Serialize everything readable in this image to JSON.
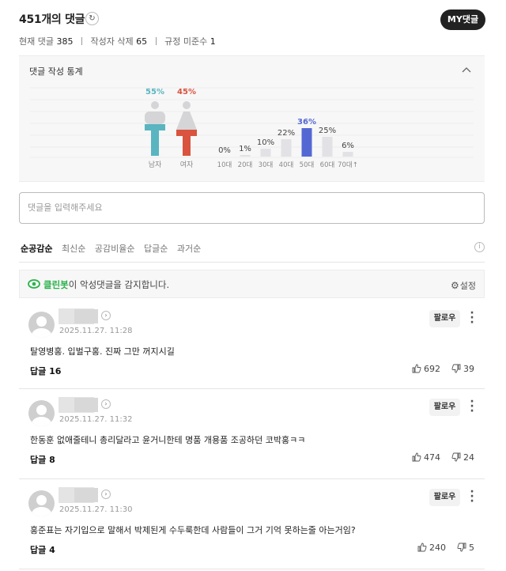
{
  "header": {
    "title": "451개의 댓글",
    "my_button": "MY댓글"
  },
  "counts": {
    "current_label": "현재 댓글",
    "current_value": "385",
    "deleted_label": "작성자 삭제",
    "deleted_value": "65",
    "violation_label": "규정 미준수",
    "violation_value": "1"
  },
  "stats": {
    "title": "댓글 작성 통계",
    "chart_data": {
      "type": "bar",
      "gender": [
        {
          "name": "남자",
          "value": 55,
          "label": "55%",
          "color": "#5ab5c0"
        },
        {
          "name": "여자",
          "value": 45,
          "label": "45%",
          "color": "#d9533f"
        }
      ],
      "age": {
        "categories": [
          "10대",
          "20대",
          "30대",
          "40대",
          "50대",
          "60대",
          "70대↑"
        ],
        "values": [
          0,
          1,
          10,
          22,
          36,
          25,
          6
        ],
        "labels": [
          "0%",
          "1%",
          "10%",
          "22%",
          "36%",
          "25%",
          "6%"
        ],
        "highlight_color": "#5468d4",
        "bar_color": "#e2e2e6"
      }
    }
  },
  "input": {
    "placeholder": "댓글을 입력해주세요"
  },
  "sort_tabs": [
    "순공감순",
    "최신순",
    "공감비율순",
    "답글순",
    "과거순"
  ],
  "cleanbot": {
    "name": "클린봇",
    "message": "이 악성댓글을 감지합니다.",
    "settings": "설정"
  },
  "comments": [
    {
      "date": "2025.11.27. 11:28",
      "text": "탈영병홍. 입벌구홍. 진짜 그만 꺼지시길",
      "reply": "답글 16",
      "likes": "692",
      "dislikes": "39",
      "follow": "팔로우"
    },
    {
      "date": "2025.11.27. 11:32",
      "text": "한동훈 없애줄테니 총리달라고 윤거니한테 명품 개용품 조공하던 코박홍ㅋㅋ",
      "reply": "답글 8",
      "likes": "474",
      "dislikes": "24",
      "follow": "팔로우"
    },
    {
      "date": "2025.11.27. 11:30",
      "text": "홍준표는 자기입으로 말해서 박제된게 수두룩한데 사람들이 그거 기억 못하는줄 아는거임?",
      "reply": "답글 4",
      "likes": "240",
      "dislikes": "5",
      "follow": "팔로우"
    }
  ]
}
